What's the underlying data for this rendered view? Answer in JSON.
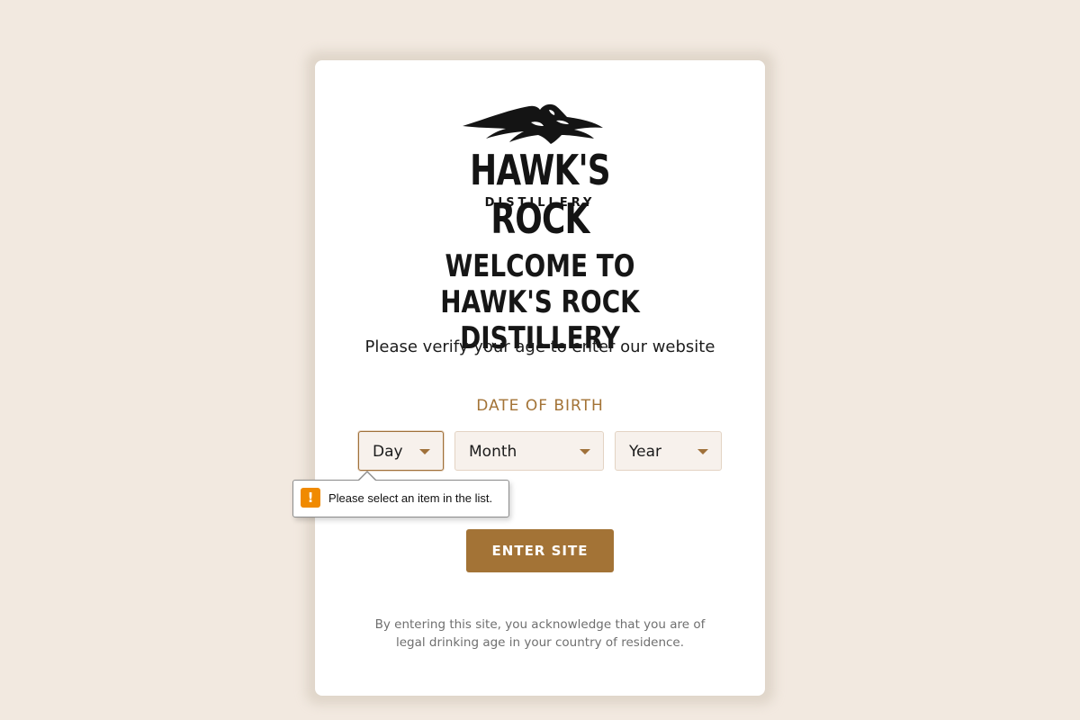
{
  "brand": {
    "logo_name": "HAWK'S ROCK",
    "logo_subname": "DISTILLERY",
    "accent_color": "#a37336",
    "background_color": "#f2e9e0"
  },
  "age_gate": {
    "title": "WELCOME TO HAWK'S ROCK DISTILLERY",
    "subtitle": "Please verify your age to enter our website",
    "dob_label": "DATE OF BIRTH",
    "day_select": {
      "placeholder": "Day"
    },
    "month_select": {
      "placeholder": "Month"
    },
    "year_select": {
      "placeholder": "Year"
    },
    "validation_tooltip": {
      "icon": "warning-icon",
      "message": "Please select an item in the list."
    },
    "enter_button_label": "ENTER SITE",
    "disclaimer": "By entering this site, you acknowledge that you are of legal drinking age in your country of residence."
  }
}
